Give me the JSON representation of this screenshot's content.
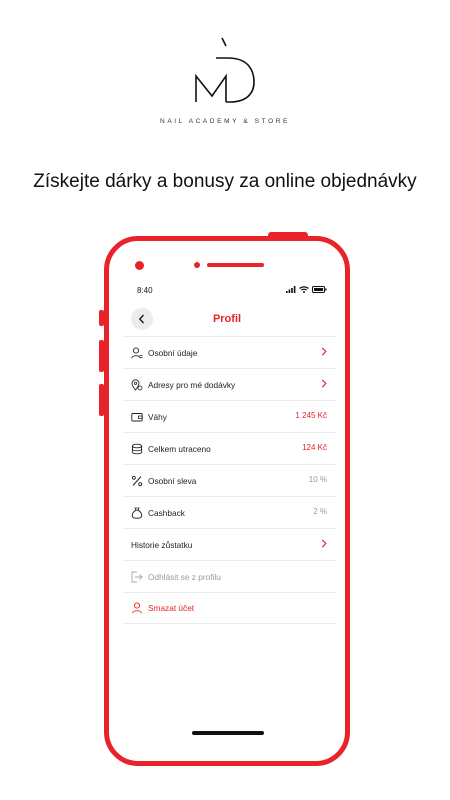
{
  "brand": {
    "subtitle": "NAIL ACADEMY & STORE",
    "accent": "#e8232a"
  },
  "headline": "Získejte dárky a bonusy za online objednávky",
  "phone": {
    "status_time": "8:40",
    "screen_title": "Profil",
    "rows": [
      {
        "icon": "user-icon",
        "label": "Osobní údaje",
        "value": "",
        "chevron": true
      },
      {
        "icon": "location-icon",
        "label": "Adresy pro mé dodávky",
        "value": "",
        "chevron": true
      },
      {
        "icon": "wallet-icon",
        "label": "Váhy",
        "value": "1 245 Kč",
        "chevron": false
      },
      {
        "icon": "coins-icon",
        "label": "Celkem utraceno",
        "value": "124 Kč",
        "chevron": false
      },
      {
        "icon": "percent-icon",
        "label": "Osobní sleva",
        "value": "10 %",
        "chevron": false
      },
      {
        "icon": "moneybag-icon",
        "label": "Cashback",
        "value": "2 %",
        "chevron": false
      },
      {
        "icon": "",
        "label": "Historie zůstatku",
        "value": "",
        "chevron": true
      },
      {
        "icon": "logout-icon",
        "label": "Odhlásit se z profilu",
        "value": "",
        "chevron": false
      },
      {
        "icon": "user-delete-icon",
        "label": "Smazat účet",
        "value": "",
        "chevron": false
      }
    ]
  }
}
